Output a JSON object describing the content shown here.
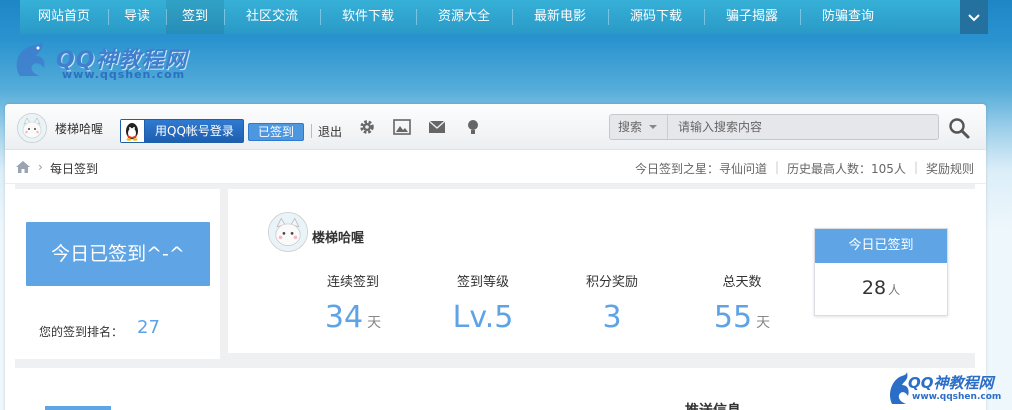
{
  "nav": {
    "items": [
      "网站首页",
      "导读",
      "签到",
      "社区交流",
      "软件下载",
      "资源大全",
      "最新电影",
      "源码下载",
      "骗子揭露",
      "防骗查询"
    ],
    "active_index": 2,
    "more_icon": "chevron-down-icon"
  },
  "logo": {
    "name": "QQ神教程网",
    "url": "www.qqshen.com"
  },
  "toolbar": {
    "username": "楼梯哈喔",
    "qq_login_label": "用QQ帐号登录",
    "signed_badge": "已签到",
    "logout": "退出",
    "icons": [
      "gear-icon",
      "image-icon",
      "mail-icon",
      "bulb-icon"
    ],
    "search": {
      "category": "搜索",
      "placeholder": "请输入搜索内容"
    }
  },
  "breadcrumb": {
    "current": "每日签到"
  },
  "stats": {
    "star": "今日签到之星：寻仙问道",
    "record": "历史最高人数：105人",
    "rules": "奖励规则"
  },
  "sign": {
    "button_label": "今日已签到^-^",
    "rank_label": "您的签到排名：",
    "rank_value": "27",
    "user": "楼梯哈喔",
    "items": [
      {
        "label": "连续签到",
        "value": "34",
        "unit": "天"
      },
      {
        "label": "签到等级",
        "value": "Lv.5",
        "unit": ""
      },
      {
        "label": "积分奖励",
        "value": "3",
        "unit": ""
      },
      {
        "label": "总天数",
        "value": "55",
        "unit": "天"
      }
    ],
    "today_label": "今日已签到",
    "today_count": "28",
    "today_unit": "人"
  },
  "lower": {
    "push_title": "推送信息"
  },
  "watermark": {
    "name": "QQ神教程网",
    "url": "www.qqshen.com"
  }
}
